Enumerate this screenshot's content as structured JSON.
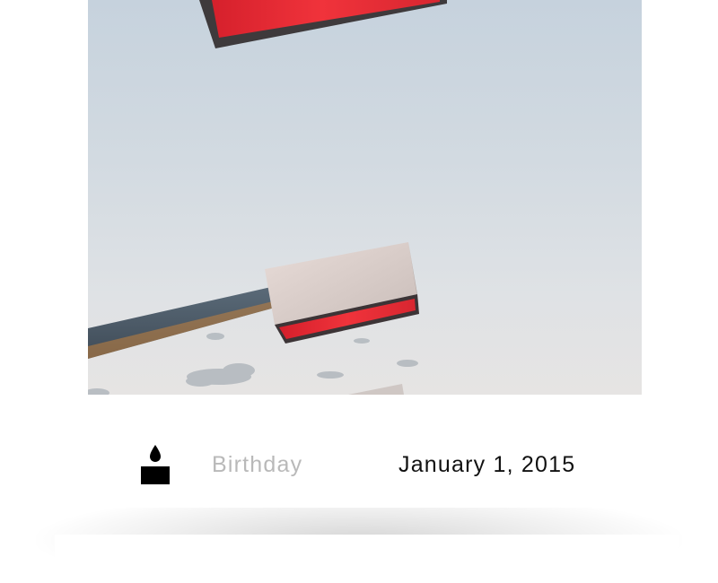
{
  "profile": {
    "birthday_label": "Birthday",
    "birthday_value": "January 1, 2015"
  },
  "icons": {
    "birthday": "birthday-cake-candle-icon"
  },
  "colors": {
    "label_text": "#b9b9b9",
    "value_text": "#111111",
    "lamp_red": "#e3262f"
  }
}
